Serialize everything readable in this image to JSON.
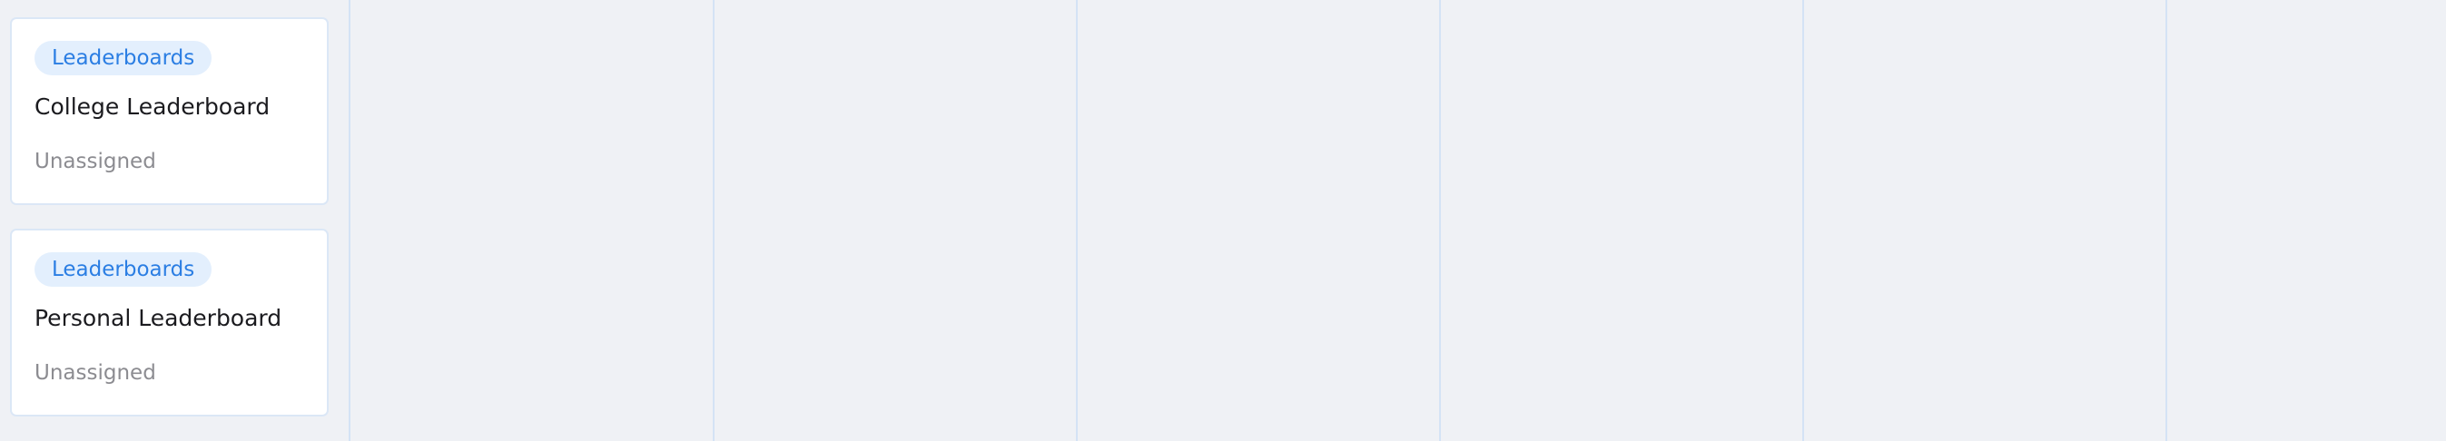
{
  "board": {
    "columns": [
      {
        "cards": [
          {
            "tag": "Leaderboards",
            "title": "College Leaderboard",
            "assignee": "Unassigned"
          },
          {
            "tag": "Leaderboards",
            "title": "Personal Leaderboard",
            "assignee": "Unassigned"
          }
        ]
      },
      {
        "cards": []
      },
      {
        "cards": []
      },
      {
        "cards": []
      },
      {
        "cards": []
      },
      {
        "cards": []
      },
      {
        "cards": []
      }
    ]
  },
  "colors": {
    "background": "#eff1f5",
    "card": "#ffffff",
    "card_border": "#dbe7f6",
    "column_divider": "#d4e3f5",
    "tag_bg": "#e3effd",
    "tag_text": "#2b7ee3",
    "title_text": "#1b1b1f",
    "muted_text": "#8c8c91"
  }
}
